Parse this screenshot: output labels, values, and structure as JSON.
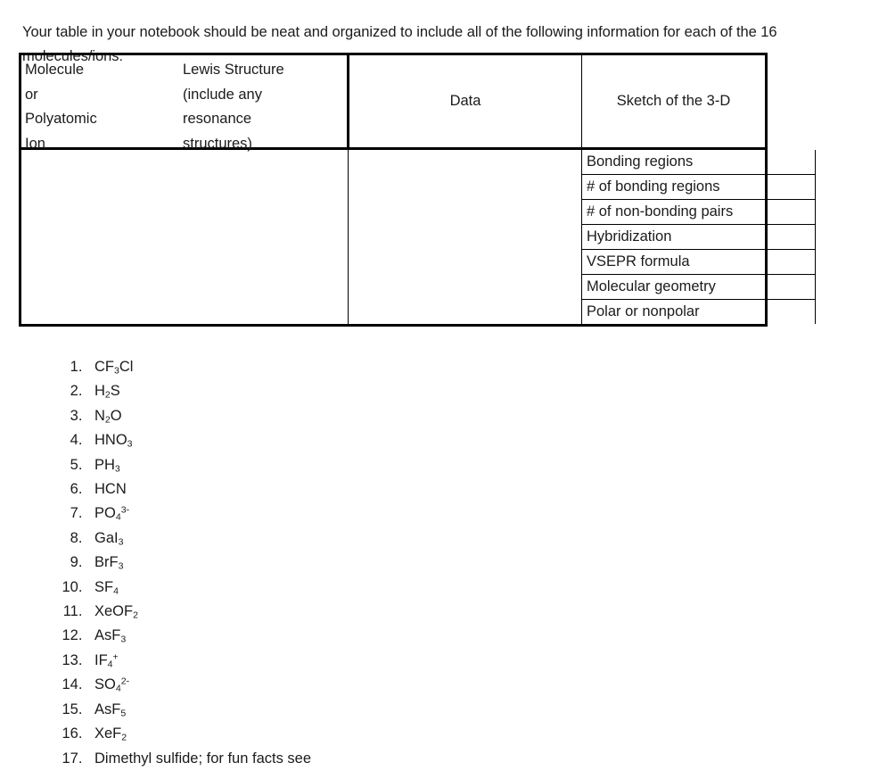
{
  "document": {
    "intro": "Your table in your notebook should be neat and organized to include all of the following information for each of the 16 molecules/ions:"
  },
  "table": {
    "headers": {
      "molecule": "Molecule\nor\nPolyatomic\nIon",
      "lewis": "Lewis Structure\n(include any\nresonance\nstructures)",
      "data": "Data",
      "sketch": "Sketch of the 3-D"
    },
    "data_rows": [
      "Bonding regions",
      "# of bonding regions",
      "# of non-bonding pairs",
      "Hybridization",
      "VSEPR formula",
      "Molecular geometry",
      "Polar or nonpolar"
    ]
  },
  "molecule_list": [
    {
      "index": 1,
      "base": "CF",
      "sub": "3",
      "sup": "",
      "tail": "Cl"
    },
    {
      "index": 2,
      "base": "H",
      "sub": "2",
      "sup": "",
      "tail": "S"
    },
    {
      "index": 3,
      "base": "N",
      "sub": "2",
      "sup": "",
      "tail": "O"
    },
    {
      "index": 4,
      "base": "HNO",
      "sub": "3",
      "sup": "",
      "tail": ""
    },
    {
      "index": 5,
      "base": "PH",
      "sub": "3",
      "sup": "",
      "tail": ""
    },
    {
      "index": 6,
      "base": "HCN",
      "sub": "",
      "sup": "",
      "tail": ""
    },
    {
      "index": 7,
      "base": "PO",
      "sub": "4",
      "sup": "3-",
      "tail": ""
    },
    {
      "index": 8,
      "base": "GaI",
      "sub": "3",
      "sup": "",
      "tail": ""
    },
    {
      "index": 9,
      "base": "BrF",
      "sub": "3",
      "sup": "",
      "tail": ""
    },
    {
      "index": 10,
      "base": "SF",
      "sub": "4",
      "sup": "",
      "tail": ""
    },
    {
      "index": 11,
      "base": "XeOF",
      "sub": "2",
      "sup": "",
      "tail": ""
    },
    {
      "index": 12,
      "base": "AsF",
      "sub": "3",
      "sup": "",
      "tail": ""
    },
    {
      "index": 13,
      "base": "IF",
      "sub": "4",
      "sup": "+",
      "tail": ""
    },
    {
      "index": 14,
      "base": "SO",
      "sub": "4",
      "sup": "2-",
      "tail": ""
    },
    {
      "index": 15,
      "base": "AsF",
      "sub": "5",
      "sup": "",
      "tail": ""
    },
    {
      "index": 16,
      "base": "XeF",
      "sub": "2",
      "sup": "",
      "tail": ""
    },
    {
      "index": 17,
      "base": "Dimethyl sulfide; for fun facts see",
      "sub": "",
      "sup": "",
      "tail": ""
    }
  ]
}
